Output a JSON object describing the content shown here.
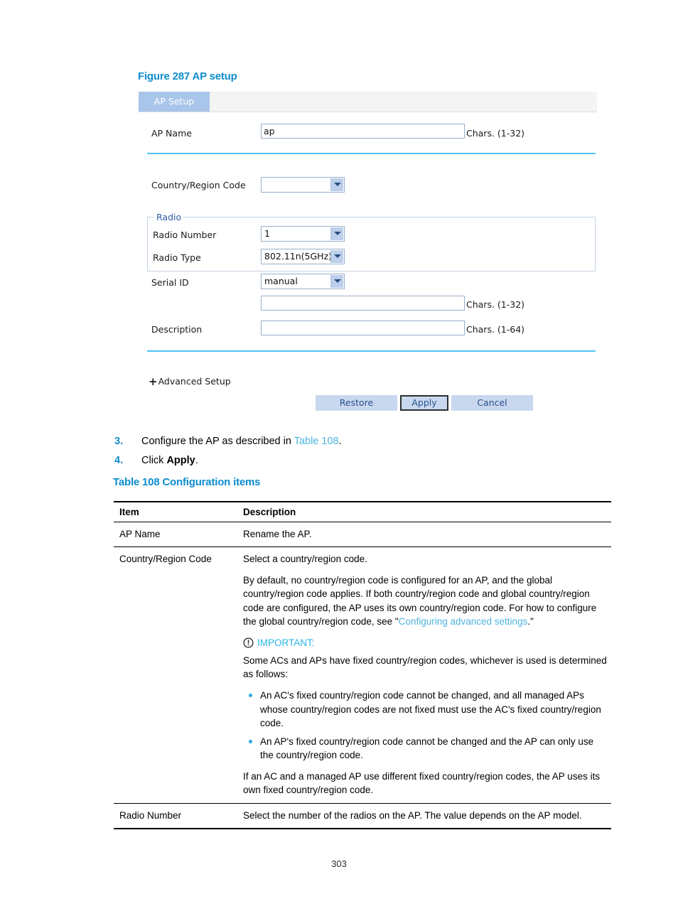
{
  "figure": {
    "caption": "Figure 287 AP setup",
    "panel": {
      "tab_label": "AP Setup",
      "fields": {
        "ap_name": {
          "label": "AP Name",
          "value": "ap",
          "hint": "Chars. (1-32)"
        },
        "country_region_code": {
          "label": "Country/Region Code",
          "value": ""
        },
        "radio_group_legend": "Radio",
        "radio_number": {
          "label": "Radio Number",
          "value": "1"
        },
        "radio_type": {
          "label": "Radio Type",
          "value": "802.11n(5GHz)"
        },
        "serial_id": {
          "label": "Serial ID",
          "value": "manual"
        },
        "serial_id_text": {
          "value": "",
          "hint": "Chars. (1-32)"
        },
        "description": {
          "label": "Description",
          "value": "",
          "hint": "Chars. (1-64)"
        }
      },
      "advanced_setup": {
        "expand_glyph": "+",
        "label": "Advanced Setup"
      },
      "buttons": {
        "restore": "Restore",
        "apply": "Apply",
        "cancel": "Cancel"
      }
    }
  },
  "steps": [
    {
      "number": "3.",
      "text_before": "Configure the AP as described in ",
      "link": "Table 108",
      "text_after": "."
    },
    {
      "number": "4.",
      "text_before": "Click ",
      "bold": "Apply",
      "text_after": "."
    }
  ],
  "table": {
    "caption": "Table 108 Configuration items",
    "headers": [
      "Item",
      "Description"
    ],
    "rows": [
      {
        "item": "AP Name",
        "description": "Rename the AP."
      },
      {
        "item": "Country/Region Code",
        "p1": "Select a country/region code.",
        "p2_before": "By default, no country/region code is configured for an AP, and the global country/region code applies. If both country/region code and global country/region code are configured, the AP uses its own country/region code. For how to configure the global country/region code, see \"",
        "p2_link": "Configuring advanced settings",
        "p2_after": ".\"",
        "important_label": "IMPORTANT:",
        "p3": "Some ACs and APs have fixed country/region codes, whichever is used is determined as follows:",
        "bullets": [
          "An AC's fixed country/region code cannot be changed, and all managed APs whose country/region codes are not fixed must use the AC's fixed country/region code.",
          "An AP's fixed country/region code cannot be changed and the AP can only use the country/region code."
        ],
        "p4": "If an AC and a managed AP use different fixed country/region codes, the AP uses its own fixed country/region code."
      },
      {
        "item": "Radio Number",
        "description": "Select the number of the radios on the AP. The value depends on the AP model."
      }
    ]
  },
  "footer": {
    "page_number": "303"
  },
  "colors": {
    "heading_blue": "#0d8ccd",
    "link_blue": "#4db4e0",
    "divider_blue": "#4dc3f7",
    "tab_blue": "#a9c5ea",
    "button_blue": "#c9d8ef",
    "important_cyan": "#29b6e8",
    "bullet_blue": "#2aa8e0"
  }
}
